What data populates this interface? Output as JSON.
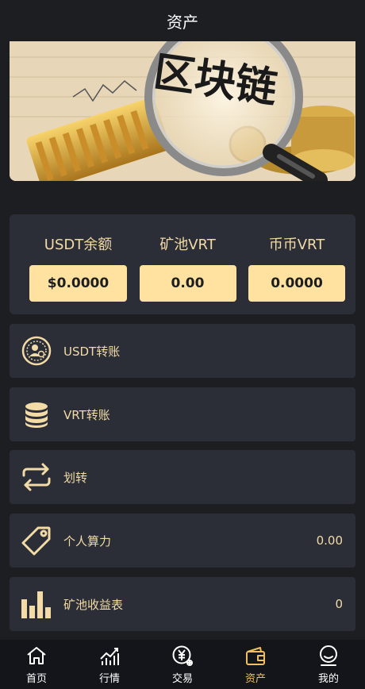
{
  "header": {
    "title": "资产"
  },
  "banner": {
    "caption": "区块链"
  },
  "balances": [
    {
      "label": "USDT余额",
      "value": "$0.0000"
    },
    {
      "label": "矿池VRT",
      "value": "0.00"
    },
    {
      "label": "币币VRT",
      "value": "0.0000"
    }
  ],
  "menu": [
    {
      "label": "USDT转账",
      "icon": "usdt-coin-icon",
      "value": ""
    },
    {
      "label": "VRT转账",
      "icon": "coin-stack-icon",
      "value": ""
    },
    {
      "label": "划转",
      "icon": "transfer-arrows-icon",
      "value": ""
    },
    {
      "label": "个人算力",
      "icon": "tag-icon",
      "value": "0.00"
    },
    {
      "label": "矿池收益表",
      "icon": "bar-chart-icon",
      "value": "0"
    }
  ],
  "tabs": [
    {
      "label": "首页",
      "icon": "home-icon",
      "active": false
    },
    {
      "label": "行情",
      "icon": "chart-icon",
      "active": false
    },
    {
      "label": "交易",
      "icon": "yuan-icon",
      "active": false
    },
    {
      "label": "资产",
      "icon": "wallet-icon",
      "active": true
    },
    {
      "label": "我的",
      "icon": "profile-icon",
      "active": false
    }
  ],
  "colors": {
    "accent": "#f2dba6",
    "button_bg": "#ffe2a0",
    "card_bg": "#2b2d37",
    "page_bg": "#1d1e22",
    "active_tab": "#f0c060"
  }
}
